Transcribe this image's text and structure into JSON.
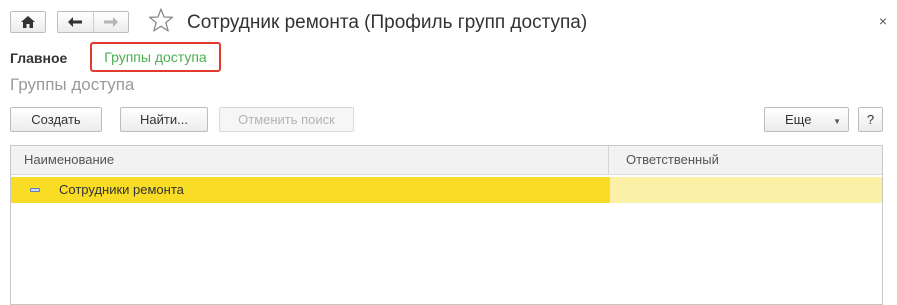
{
  "window": {
    "title": "Сотрудник ремонта (Профиль групп доступа)",
    "close_glyph": "×"
  },
  "nav": {
    "home_icon": "home-icon",
    "back_icon": "arrow-left-icon",
    "forward_icon": "arrow-right-icon",
    "favorite_icon": "star-icon"
  },
  "tabs": {
    "main": "Главное",
    "groups": "Группы доступа"
  },
  "section_title": "Группы доступа",
  "toolbar": {
    "create": "Создать",
    "find": "Найти...",
    "cancel_search": "Отменить поиск",
    "more": "Еще",
    "help": "?"
  },
  "table": {
    "columns": [
      "Наименование",
      "Ответственный"
    ],
    "rows": [
      {
        "name": "Сотрудники ремонта",
        "responsible": ""
      }
    ]
  },
  "colors": {
    "selected_row": "#f9dc26",
    "selected_row_secondary": "#fbf1a6",
    "tab_link": "#4caf50",
    "highlight_border": "#e23a2d"
  }
}
